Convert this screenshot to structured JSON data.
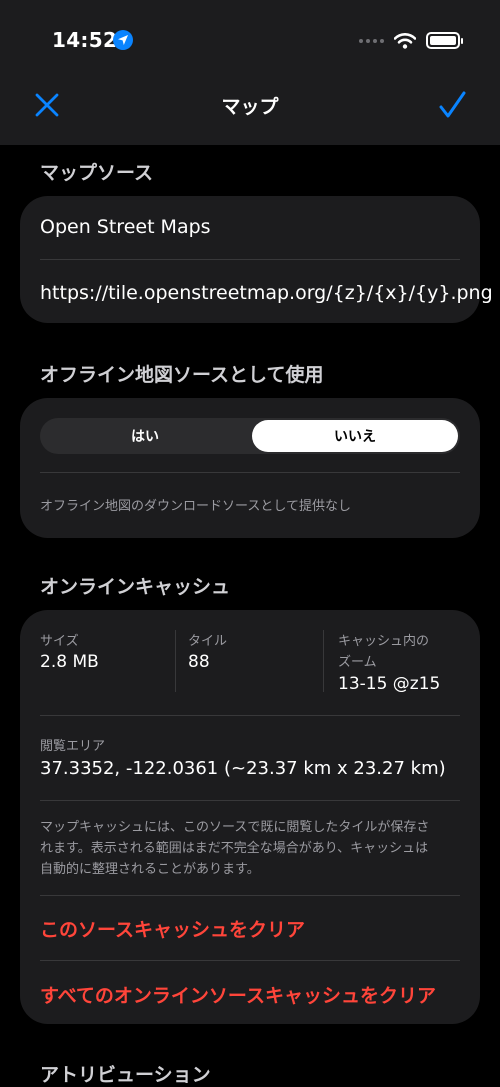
{
  "status_bar": {
    "time": "14:52"
  },
  "nav": {
    "title": "マップ"
  },
  "map_source": {
    "header": "マップソース",
    "name": "Open Street Maps",
    "url": "https://tile.openstreetmap.org/{z}/{x}/{y}.png"
  },
  "offline": {
    "header": "オフライン地図ソースとして使用",
    "options": [
      "はい",
      "いいえ"
    ],
    "selected": "いいえ",
    "note": "オフライン地図のダウンロードソースとして提供なし"
  },
  "cache": {
    "header": "オンラインキャッシュ",
    "size_label": "サイズ",
    "size_value": "2.8 MB",
    "tiles_label": "タイル",
    "tiles_value": "88",
    "zoom_label_1": "キャッシュ内の",
    "zoom_label_2": "ズーム",
    "zoom_value": "13-15 @z15",
    "area_label": "閲覧エリア",
    "area_value": "37.3352, -122.0361  (~23.37 km x 23.27 km)",
    "desc_1": "マップキャッシュには、このソースで既に閲覧したタイルが保存さ",
    "desc_2": "れます。表示される範囲はまだ不完全な場合があり、キャッシュは",
    "desc_3": "自動的に整理されることがあります。",
    "clear_this": "このソースキャッシュをクリア",
    "clear_all": "すべてのオンラインソースキャッシュをクリア"
  },
  "attribution": {
    "header": "アトリビューション"
  },
  "colors": {
    "accent": "#0a84ff",
    "destructive": "#ff453a",
    "card": "#1c1c1e"
  }
}
